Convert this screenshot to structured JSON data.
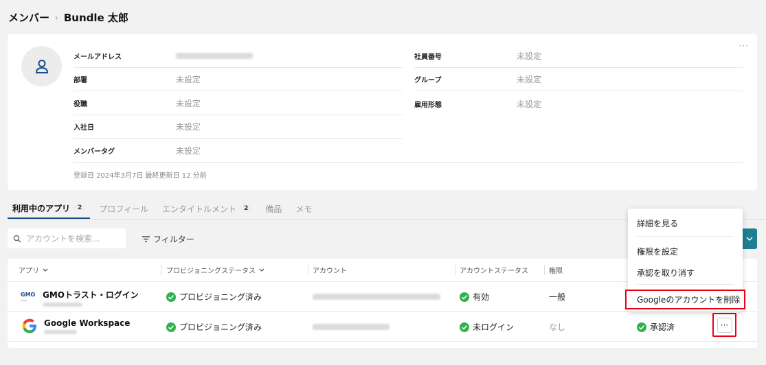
{
  "breadcrumb": {
    "parent": "メンバー",
    "separator": "›",
    "current": "Bundle 太郎"
  },
  "profile": {
    "more": "···",
    "fields": {
      "email": {
        "label": "メールアドレス",
        "value": ""
      },
      "department": {
        "label": "部署",
        "value": "未設定"
      },
      "position": {
        "label": "役職",
        "value": "未設定"
      },
      "joined": {
        "label": "入社日",
        "value": "未設定"
      },
      "member_tag": {
        "label": "メンバータグ",
        "value": "未設定"
      },
      "employee_no": {
        "label": "社員番号",
        "value": "未設定"
      },
      "group": {
        "label": "グループ",
        "value": "未設定"
      },
      "employment": {
        "label": "雇用形態",
        "value": "未設定"
      }
    },
    "meta": "登録日 2024年3月7日  最終更新日 12 分前"
  },
  "tabs": [
    {
      "label": "利用中のアプリ",
      "badge": "2"
    },
    {
      "label": "プロフィール"
    },
    {
      "label": "エンタイトルメント",
      "badge": "2"
    },
    {
      "label": "備品"
    },
    {
      "label": "メモ"
    }
  ],
  "search": {
    "placeholder": "アカウントを検索..."
  },
  "filter": {
    "label": "フィルター"
  },
  "table": {
    "headers": {
      "app": "アプリ",
      "provisioning": "プロビジョニングステータス",
      "account": "アカウント",
      "account_status": "アカウントステータス",
      "permission": "権限"
    },
    "rows": [
      {
        "app": "GMOトラスト・ログイン",
        "logo_text": "GMO",
        "provisioning": "プロビジョニング済み",
        "account_status": "有効",
        "permission": "一般",
        "approval": ""
      },
      {
        "app": "Google Workspace",
        "logo_text": "G",
        "provisioning": "プロビジョニング済み",
        "account_status": "未ログイン",
        "permission": "なし",
        "approval": "承認済"
      }
    ],
    "row_more": "···"
  },
  "menu": {
    "items": [
      "詳細を見る",
      "権限を設定",
      "承認を取り消す"
    ],
    "danger": "Googleのアカウントを削除"
  },
  "colors": {
    "accent": "#1b4b8a",
    "teal": "#1e7f91",
    "success": "#2db34a",
    "highlight": "#e01010"
  }
}
